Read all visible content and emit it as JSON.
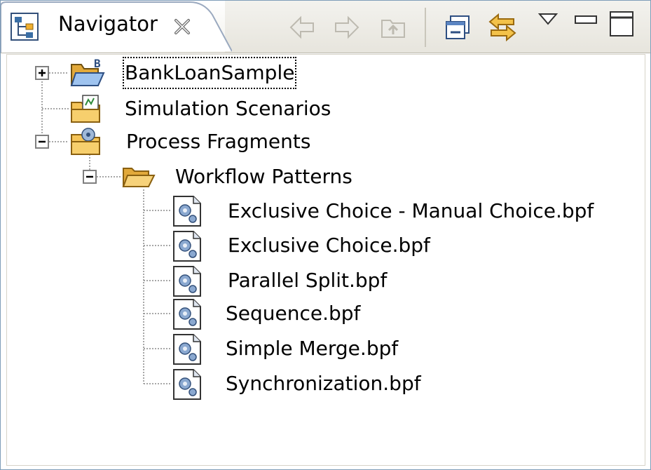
{
  "view": {
    "title": "Navigator",
    "toolbar": {
      "back_icon": "back-arrow-icon",
      "forward_icon": "forward-arrow-icon",
      "up_icon": "up-folder-icon",
      "collapse_all_icon": "collapse-all-icon",
      "link_editor_icon": "link-with-editor-icon",
      "menu_icon": "view-menu-triangle-icon",
      "minimize_icon": "minimize-icon",
      "maximize_icon": "maximize-icon"
    }
  },
  "tree": {
    "nodes": [
      {
        "label": "BankLoanSample",
        "icon": "project-folder-icon",
        "expanded": false,
        "selected": true
      },
      {
        "label": "Simulation Scenarios",
        "icon": "simulation-folder-icon"
      },
      {
        "label": "Process Fragments",
        "icon": "process-folder-icon",
        "expanded": true
      },
      {
        "label": "Workflow Patterns",
        "icon": "open-folder-icon",
        "expanded": true
      },
      {
        "label": "Exclusive Choice - Manual Choice.bpf",
        "icon": "bpf-file-icon"
      },
      {
        "label": "Exclusive Choice.bpf",
        "icon": "bpf-file-icon"
      },
      {
        "label": "Parallel Split.bpf",
        "icon": "bpf-file-icon"
      },
      {
        "label": "Sequence.bpf",
        "icon": "bpf-file-icon"
      },
      {
        "label": "Simple Merge.bpf",
        "icon": "bpf-file-icon"
      },
      {
        "label": "Synchronization.bpf",
        "icon": "bpf-file-icon"
      }
    ]
  },
  "colors": {
    "border": "#7f9db9",
    "folder": "#f5c458",
    "accent": "#3a6ea5"
  }
}
